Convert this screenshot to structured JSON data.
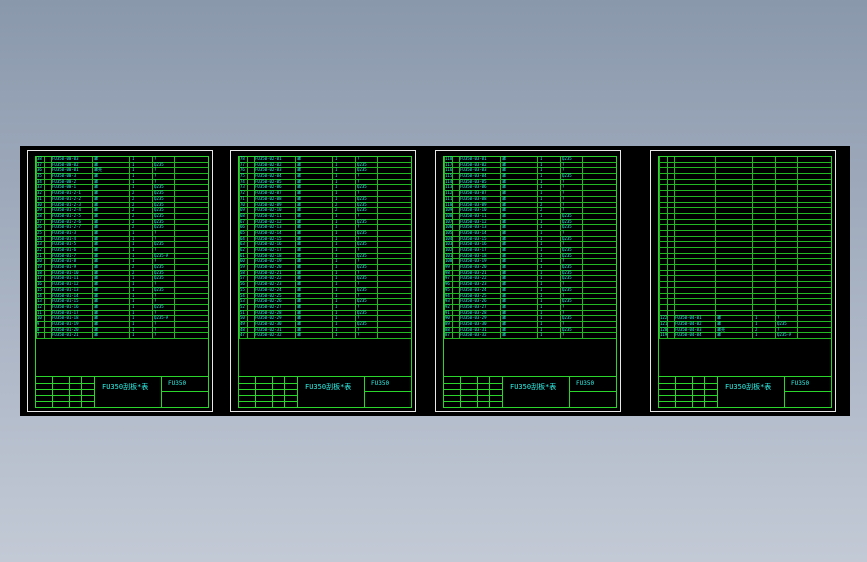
{
  "drawing_title": "FU350刮板*表",
  "drawing_code": "FU350",
  "sheets": [
    {
      "id": "sheet-1",
      "rows": [
        {
          "no": "38",
          "code": "FU350-00-03",
          "name": "罩",
          "qty": "1",
          "mat": "?"
        },
        {
          "no": "37",
          "code": "FU350-00-02",
          "name": "罩",
          "qty": "1",
          "mat": "Q235"
        },
        {
          "no": "36",
          "code": "FU350-00-01",
          "name": "罩壳",
          "qty": "1",
          "mat": "?"
        },
        {
          "no": "35",
          "code": "FU350-00-3",
          "name": "罩",
          "qty": "1",
          "mat": "?"
        },
        {
          "no": "34",
          "code": "FU350-00-2",
          "name": "罩",
          "qty": "1",
          "mat": "?"
        },
        {
          "no": "33",
          "code": "FU350-00-1",
          "name": "罩",
          "qty": "1",
          "mat": "Q235"
        },
        {
          "no": "32",
          "code": "FU350-01-2-1",
          "name": "罩",
          "qty": "2",
          "mat": "Q235"
        },
        {
          "no": "31",
          "code": "FU350-01-2-2",
          "name": "罩",
          "qty": "2",
          "mat": "Q235"
        },
        {
          "no": "30",
          "code": "FU350-01-2-3",
          "name": "罩",
          "qty": "2",
          "mat": "Q235"
        },
        {
          "no": "29",
          "code": "FU350-01-2-4",
          "name": "罩",
          "qty": "2",
          "mat": "Q235"
        },
        {
          "no": "28",
          "code": "FU350-01-2-5",
          "name": "罩",
          "qty": "2",
          "mat": "Q235"
        },
        {
          "no": "27",
          "code": "FU350-01-2-6",
          "name": "罩",
          "qty": "2",
          "mat": "Q235"
        },
        {
          "no": "26",
          "code": "FU350-01-2-7",
          "name": "罩",
          "qty": "2",
          "mat": "Q235"
        },
        {
          "no": "25",
          "code": "FU350-01-3",
          "name": "罩",
          "qty": "1",
          "mat": "?"
        },
        {
          "no": "24",
          "code": "FU350-01-4",
          "name": "罩",
          "qty": "1",
          "mat": "?"
        },
        {
          "no": "23",
          "code": "FU350-01-5",
          "name": "罩",
          "qty": "1",
          "mat": "Q235"
        },
        {
          "no": "22",
          "code": "FU350-01-6",
          "name": "罩",
          "qty": "1",
          "mat": "?"
        },
        {
          "no": "21",
          "code": "FU350-01-7",
          "name": "罩",
          "qty": "1",
          "mat": "Q235-A"
        },
        {
          "no": "20",
          "code": "FU350-01-8",
          "name": "罩",
          "qty": "1",
          "mat": "?"
        },
        {
          "no": "19",
          "code": "FU350-01-9",
          "name": "罩",
          "qty": "2",
          "mat": "Q235"
        },
        {
          "no": "18",
          "code": "FU350-01-10",
          "name": "罩",
          "qty": "2",
          "mat": "Q235"
        },
        {
          "no": "17",
          "code": "FU350-01-11",
          "name": "罩",
          "qty": "1",
          "mat": "Q235"
        },
        {
          "no": "16",
          "code": "FU350-01-12",
          "name": "罩",
          "qty": "1",
          "mat": "?"
        },
        {
          "no": "15",
          "code": "FU350-01-13",
          "name": "罩",
          "qty": "1",
          "mat": "Q235"
        },
        {
          "no": "14",
          "code": "FU350-01-14",
          "name": "罩",
          "qty": "1",
          "mat": "?"
        },
        {
          "no": "13",
          "code": "FU350-01-15",
          "name": "罩",
          "qty": "1",
          "mat": "?"
        },
        {
          "no": "12",
          "code": "FU350-01-16",
          "name": "罩",
          "qty": "1",
          "mat": "Q235"
        },
        {
          "no": "11",
          "code": "FU350-01-17",
          "name": "罩",
          "qty": "1",
          "mat": "?"
        },
        {
          "no": "10",
          "code": "FU350-01-18",
          "name": "罩",
          "qty": "1",
          "mat": "Q235-A"
        },
        {
          "no": "9",
          "code": "FU350-01-19",
          "name": "罩",
          "qty": "1",
          "mat": "?"
        },
        {
          "no": "8",
          "code": "FU350-01-20",
          "name": "罩",
          "qty": "1",
          "mat": "?"
        },
        {
          "no": "7",
          "code": "FU350-01-21",
          "name": "罩",
          "qty": "1",
          "mat": "?"
        }
      ]
    },
    {
      "id": "sheet-2",
      "rows": [
        {
          "no": "78",
          "code": "FU350-02-01",
          "name": "罩",
          "qty": "1",
          "mat": "?"
        },
        {
          "no": "77",
          "code": "FU350-02-02",
          "name": "罩",
          "qty": "1",
          "mat": "Q235"
        },
        {
          "no": "76",
          "code": "FU350-02-03",
          "name": "罩",
          "qty": "1",
          "mat": "Q235"
        },
        {
          "no": "75",
          "code": "FU350-02-04",
          "name": "罩",
          "qty": "1",
          "mat": "?"
        },
        {
          "no": "74",
          "code": "FU350-02-05",
          "name": "罩",
          "qty": "1",
          "mat": "?"
        },
        {
          "no": "73",
          "code": "FU350-02-06",
          "name": "罩",
          "qty": "1",
          "mat": "Q235"
        },
        {
          "no": "72",
          "code": "FU350-02-07",
          "name": "罩",
          "qty": "1",
          "mat": "?"
        },
        {
          "no": "71",
          "code": "FU350-02-08",
          "name": "罩",
          "qty": "1",
          "mat": "Q235"
        },
        {
          "no": "70",
          "code": "FU350-02-09",
          "name": "罩",
          "qty": "2",
          "mat": "Q235"
        },
        {
          "no": "69",
          "code": "FU350-02-10",
          "name": "罩",
          "qty": "2",
          "mat": "Q235"
        },
        {
          "no": "68",
          "code": "FU350-02-11",
          "name": "罩",
          "qty": "1",
          "mat": "?"
        },
        {
          "no": "67",
          "code": "FU350-02-12",
          "name": "罩",
          "qty": "1",
          "mat": "Q235"
        },
        {
          "no": "66",
          "code": "FU350-02-13",
          "name": "罩",
          "qty": "1",
          "mat": "?"
        },
        {
          "no": "65",
          "code": "FU350-02-14",
          "name": "罩",
          "qty": "1",
          "mat": "Q235"
        },
        {
          "no": "64",
          "code": "FU350-02-15",
          "name": "罩",
          "qty": "1",
          "mat": "?"
        },
        {
          "no": "63",
          "code": "FU350-02-16",
          "name": "罩",
          "qty": "1",
          "mat": "Q235"
        },
        {
          "no": "62",
          "code": "FU350-02-17",
          "name": "罩",
          "qty": "1",
          "mat": "?"
        },
        {
          "no": "61",
          "code": "FU350-02-18",
          "name": "罩",
          "qty": "1",
          "mat": "Q235"
        },
        {
          "no": "60",
          "code": "FU350-02-19",
          "name": "罩",
          "qty": "1",
          "mat": "?"
        },
        {
          "no": "59",
          "code": "FU350-02-20",
          "name": "罩",
          "qty": "1",
          "mat": "Q235"
        },
        {
          "no": "58",
          "code": "FU350-02-21",
          "name": "罩",
          "qty": "1",
          "mat": "?"
        },
        {
          "no": "57",
          "code": "FU350-02-22",
          "name": "罩",
          "qty": "1",
          "mat": "Q235"
        },
        {
          "no": "56",
          "code": "FU350-02-23",
          "name": "罩",
          "qty": "1",
          "mat": "?"
        },
        {
          "no": "55",
          "code": "FU350-02-24",
          "name": "罩",
          "qty": "1",
          "mat": "Q235"
        },
        {
          "no": "54",
          "code": "FU350-02-25",
          "name": "罩",
          "qty": "1",
          "mat": "?"
        },
        {
          "no": "53",
          "code": "FU350-02-26",
          "name": "罩",
          "qty": "1",
          "mat": "Q235"
        },
        {
          "no": "52",
          "code": "FU350-02-27",
          "name": "罩",
          "qty": "1",
          "mat": "?"
        },
        {
          "no": "51",
          "code": "FU350-02-28",
          "name": "罩",
          "qty": "1",
          "mat": "Q235"
        },
        {
          "no": "50",
          "code": "FU350-02-29",
          "name": "罩",
          "qty": "1",
          "mat": "?"
        },
        {
          "no": "49",
          "code": "FU350-02-30",
          "name": "罩",
          "qty": "1",
          "mat": "Q235"
        },
        {
          "no": "48",
          "code": "FU350-02-31",
          "name": "罩",
          "qty": "1",
          "mat": "?"
        },
        {
          "no": "47",
          "code": "FU350-02-32",
          "name": "罩",
          "qty": "1",
          "mat": "?"
        }
      ]
    },
    {
      "id": "sheet-3",
      "rows": [
        {
          "no": "118",
          "code": "FU350-03-01",
          "name": "罩",
          "qty": "1",
          "mat": "Q235"
        },
        {
          "no": "117",
          "code": "FU350-03-02",
          "name": "罩",
          "qty": "1",
          "mat": "?"
        },
        {
          "no": "116",
          "code": "FU350-03-03",
          "name": "罩",
          "qty": "1",
          "mat": "?"
        },
        {
          "no": "115",
          "code": "FU350-03-04",
          "name": "罩",
          "qty": "1",
          "mat": "Q235"
        },
        {
          "no": "114",
          "code": "FU350-03-05",
          "name": "罩",
          "qty": "1",
          "mat": "?"
        },
        {
          "no": "113",
          "code": "FU350-03-06",
          "name": "罩",
          "qty": "1",
          "mat": "?"
        },
        {
          "no": "112",
          "code": "FU350-03-07",
          "name": "罩",
          "qty": "1",
          "mat": "?"
        },
        {
          "no": "111",
          "code": "FU350-03-08",
          "name": "罩",
          "qty": "1",
          "mat": "?"
        },
        {
          "no": "110",
          "code": "FU350-03-09",
          "name": "罩",
          "qty": "2",
          "mat": "?"
        },
        {
          "no": "109",
          "code": "FU350-03-10",
          "name": "罩",
          "qty": "2",
          "mat": "?"
        },
        {
          "no": "108",
          "code": "FU350-03-11",
          "name": "罩",
          "qty": "1",
          "mat": "Q235"
        },
        {
          "no": "107",
          "code": "FU350-03-12",
          "name": "罩",
          "qty": "1",
          "mat": "Q235"
        },
        {
          "no": "106",
          "code": "FU350-03-13",
          "name": "罩",
          "qty": "1",
          "mat": "Q235"
        },
        {
          "no": "105",
          "code": "FU350-03-14",
          "name": "罩",
          "qty": "1",
          "mat": "?"
        },
        {
          "no": "104",
          "code": "FU350-03-15",
          "name": "罩",
          "qty": "1",
          "mat": "Q235"
        },
        {
          "no": "103",
          "code": "FU350-03-16",
          "name": "罩",
          "qty": "1",
          "mat": "?"
        },
        {
          "no": "102",
          "code": "FU350-03-17",
          "name": "罩",
          "qty": "1",
          "mat": "Q235"
        },
        {
          "no": "101",
          "code": "FU350-03-18",
          "name": "罩",
          "qty": "1",
          "mat": "Q235"
        },
        {
          "no": "100",
          "code": "FU350-03-19",
          "name": "罩",
          "qty": "1",
          "mat": "?"
        },
        {
          "no": "99",
          "code": "FU350-03-20",
          "name": "罩",
          "qty": "1",
          "mat": "Q235"
        },
        {
          "no": "98",
          "code": "FU350-03-21",
          "name": "罩",
          "qty": "1",
          "mat": "Q235"
        },
        {
          "no": "97",
          "code": "FU350-03-22",
          "name": "罩",
          "qty": "1",
          "mat": "Q235"
        },
        {
          "no": "96",
          "code": "FU350-03-23",
          "name": "罩",
          "qty": "1",
          "mat": "?"
        },
        {
          "no": "95",
          "code": "FU350-03-24",
          "name": "罩",
          "qty": "1",
          "mat": "Q235"
        },
        {
          "no": "94",
          "code": "FU350-03-25",
          "name": "罩",
          "qty": "1",
          "mat": "?"
        },
        {
          "no": "93",
          "code": "FU350-03-26",
          "name": "罩",
          "qty": "1",
          "mat": "Q235"
        },
        {
          "no": "92",
          "code": "FU350-03-27",
          "name": "罩",
          "qty": "1",
          "mat": "?"
        },
        {
          "no": "91",
          "code": "FU350-03-28",
          "name": "罩",
          "qty": "1",
          "mat": "?"
        },
        {
          "no": "90",
          "code": "FU350-03-29",
          "name": "罩",
          "qty": "1",
          "mat": "Q235"
        },
        {
          "no": "89",
          "code": "FU350-03-30",
          "name": "罩",
          "qty": "1",
          "mat": "?"
        },
        {
          "no": "88",
          "code": "FU350-03-31",
          "name": "罩",
          "qty": "1",
          "mat": "Q235"
        },
        {
          "no": "87",
          "code": "FU350-03-32",
          "name": "罩",
          "qty": "1",
          "mat": "?"
        }
      ]
    },
    {
      "id": "sheet-4",
      "rows": [
        {
          "no": "",
          "code": "",
          "name": "",
          "qty": "",
          "mat": ""
        },
        {
          "no": "",
          "code": "",
          "name": "",
          "qty": "",
          "mat": ""
        },
        {
          "no": "",
          "code": "",
          "name": "",
          "qty": "",
          "mat": ""
        },
        {
          "no": "",
          "code": "",
          "name": "",
          "qty": "",
          "mat": ""
        },
        {
          "no": "",
          "code": "",
          "name": "",
          "qty": "",
          "mat": ""
        },
        {
          "no": "",
          "code": "",
          "name": "",
          "qty": "",
          "mat": ""
        },
        {
          "no": "",
          "code": "",
          "name": "",
          "qty": "",
          "mat": ""
        },
        {
          "no": "",
          "code": "",
          "name": "",
          "qty": "",
          "mat": ""
        },
        {
          "no": "",
          "code": "",
          "name": "",
          "qty": "",
          "mat": ""
        },
        {
          "no": "",
          "code": "",
          "name": "",
          "qty": "",
          "mat": ""
        },
        {
          "no": "",
          "code": "",
          "name": "",
          "qty": "",
          "mat": ""
        },
        {
          "no": "",
          "code": "",
          "name": "",
          "qty": "",
          "mat": ""
        },
        {
          "no": "",
          "code": "",
          "name": "",
          "qty": "",
          "mat": ""
        },
        {
          "no": "",
          "code": "",
          "name": "",
          "qty": "",
          "mat": ""
        },
        {
          "no": "",
          "code": "",
          "name": "",
          "qty": "",
          "mat": ""
        },
        {
          "no": "",
          "code": "",
          "name": "",
          "qty": "",
          "mat": ""
        },
        {
          "no": "",
          "code": "",
          "name": "",
          "qty": "",
          "mat": ""
        },
        {
          "no": "",
          "code": "",
          "name": "",
          "qty": "",
          "mat": ""
        },
        {
          "no": "",
          "code": "",
          "name": "",
          "qty": "",
          "mat": ""
        },
        {
          "no": "",
          "code": "",
          "name": "",
          "qty": "",
          "mat": ""
        },
        {
          "no": "",
          "code": "",
          "name": "",
          "qty": "",
          "mat": ""
        },
        {
          "no": "",
          "code": "",
          "name": "",
          "qty": "",
          "mat": ""
        },
        {
          "no": "",
          "code": "",
          "name": "",
          "qty": "",
          "mat": ""
        },
        {
          "no": "",
          "code": "",
          "name": "",
          "qty": "",
          "mat": ""
        },
        {
          "no": "",
          "code": "",
          "name": "",
          "qty": "",
          "mat": ""
        },
        {
          "no": "",
          "code": "",
          "name": "",
          "qty": "",
          "mat": ""
        },
        {
          "no": "",
          "code": "",
          "name": "",
          "qty": "",
          "mat": ""
        },
        {
          "no": "",
          "code": "",
          "name": "",
          "qty": "",
          "mat": ""
        },
        {
          "no": "122",
          "code": "FU350-04-01",
          "name": "罩",
          "qty": "1",
          "mat": "?"
        },
        {
          "no": "121",
          "code": "FU350-04-02",
          "name": "罩",
          "qty": "1",
          "mat": "Q235"
        },
        {
          "no": "120",
          "code": "FU350-04-03",
          "name": "罩壳",
          "qty": "2",
          "mat": "?"
        },
        {
          "no": "119",
          "code": "FU350-04-04",
          "name": "罩",
          "qty": "1",
          "mat": "Q235-A"
        }
      ]
    }
  ],
  "colors": {
    "background_top": "#8a98ac",
    "background_bottom": "#c3cad6",
    "canvas": "#000000",
    "sheet_border": "#e8e8e8",
    "frame_line": "#2bd52b",
    "table_line": "#23b823",
    "text": "#2ef2e8"
  }
}
